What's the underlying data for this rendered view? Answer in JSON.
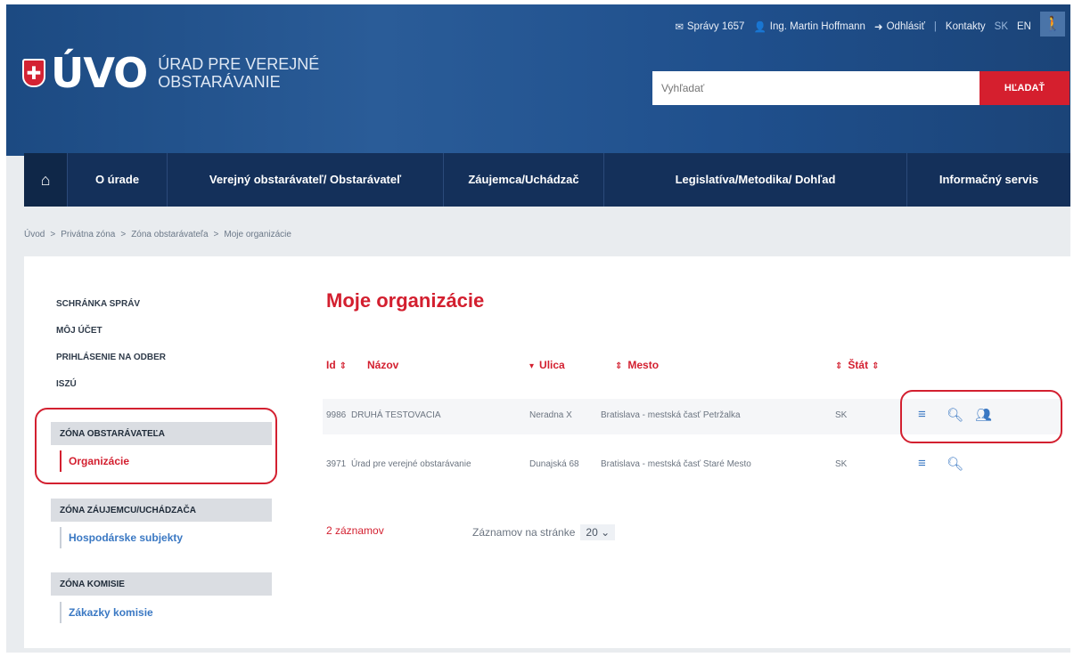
{
  "topbar": {
    "messages": "Správy 1657",
    "user": "Ing. Martin Hoffmann",
    "logout": "Odhlásiť",
    "contacts": "Kontakty",
    "lang_sk": "SK",
    "lang_en": "EN"
  },
  "logo": {
    "shield_glyph": "✚",
    "short": "ÚVO",
    "line1": "ÚRAD PRE VEREJNÉ",
    "line2": "OBSTARÁVANIE"
  },
  "search": {
    "placeholder": "Vyhľadať",
    "button": "HĽADAŤ"
  },
  "nav": {
    "home_icon": "⌂",
    "items": [
      "O úrade",
      "Verejný obstarávateľ/ Obstarávateľ",
      "Záujemca/Uchádzač",
      "Legislatíva/Metodika/ Dohľad",
      "Informačný servis"
    ]
  },
  "breadcrumb": [
    "Úvod",
    "Privátna zóna",
    "Zóna obstarávateľa",
    "Moje organizácie"
  ],
  "sidebar": {
    "links": [
      "SCHRÁNKA SPRÁV",
      "MÔJ ÚČET",
      "PRIHLÁSENIE NA ODBER",
      "ISZÚ"
    ],
    "zones": [
      {
        "head": "ZÓNA OBSTARÁVATEĽA",
        "sub": "Organizácie"
      },
      {
        "head": "ZÓNA ZÁUJEMCU/UCHÁDZAČA",
        "sub": "Hospodárske subjekty"
      },
      {
        "head": "ZÓNA KOMISIE",
        "sub": "Zákazky komisie"
      }
    ]
  },
  "main": {
    "title": "Moje organizácie",
    "columns": [
      "Id",
      "Názov",
      "Ulica",
      "Mesto",
      "Štát"
    ],
    "rows": [
      {
        "id": "9986",
        "name": "DRUHÁ TESTOVACIA",
        "street": "Neradna X",
        "city": "Bratislava - mestská časť Petržalka",
        "state": "SK"
      },
      {
        "id": "3971",
        "name": "Úrad pre verejné obstarávanie",
        "street": "Dunajská 68",
        "city": "Bratislava - mestská časť Staré Mesto",
        "state": "SK"
      }
    ],
    "count": "2 záznamov",
    "perpage_label": "Záznamov na stránke",
    "perpage_value": "20"
  },
  "colors": {
    "accent_red": "#d31f2f",
    "header_blue": "#1f4f8c",
    "nav_dark": "#14305a",
    "link_blue": "#3a78c3"
  }
}
